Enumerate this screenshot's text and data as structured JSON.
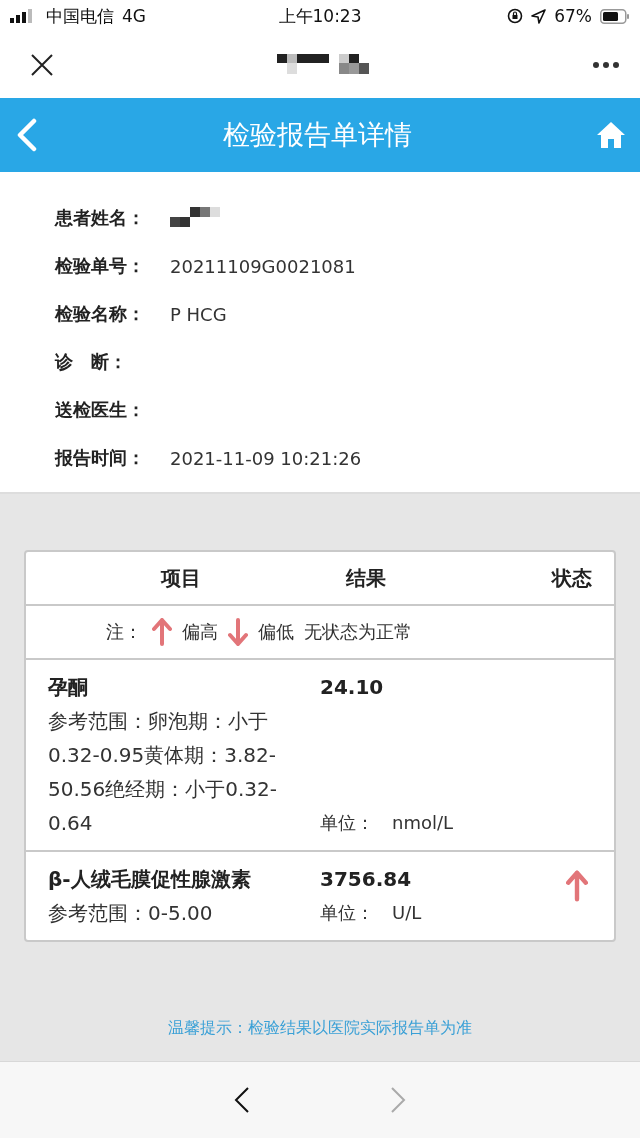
{
  "status_bar": {
    "carrier": "中国电信",
    "network": "4G",
    "time": "上午10:23",
    "battery": "67%"
  },
  "header": {
    "title": "检验报告单详情"
  },
  "patient_info": [
    {
      "label": "患者姓名：",
      "redacted": true
    },
    {
      "label": "检验单号：",
      "value": "20211109G0021081",
      "redacted": false
    },
    {
      "label": "检验名称：",
      "value": "P HCG",
      "redacted": false
    },
    {
      "label": "诊　断：",
      "redacted": false
    },
    {
      "label": "送检医生：",
      "redacted": false
    },
    {
      "label": "报告时间：",
      "value": "2021-11-09 10:21:26",
      "redacted": false
    }
  ],
  "table": {
    "columns": [
      "项目",
      "结果",
      "状态"
    ],
    "legend": {
      "prefix": "注：",
      "high": "偏高",
      "low": "偏低",
      "normal": "无状态为正常"
    },
    "rows": [
      {
        "name": "孕酮",
        "reference": "参考范围：卵泡期：小于0.32-0.95黄体期：3.82-50.56绝经期：小于0.32-0.64",
        "result": "24.10",
        "unit_label": "单位：",
        "unit": "nmol/L",
        "high": false,
        "low": false
      },
      {
        "name": "β-人绒毛膜促性腺激素",
        "reference": "参考范围：0-5.00",
        "result": "3756.84",
        "unit_label": "单位：",
        "unit": "U/L",
        "high": true,
        "low": false
      }
    ]
  },
  "tip": "温馨提示：检验结果以医院实际报告单为准",
  "bottom_nav": {
    "back_disabled": false,
    "forward_disabled": true
  }
}
